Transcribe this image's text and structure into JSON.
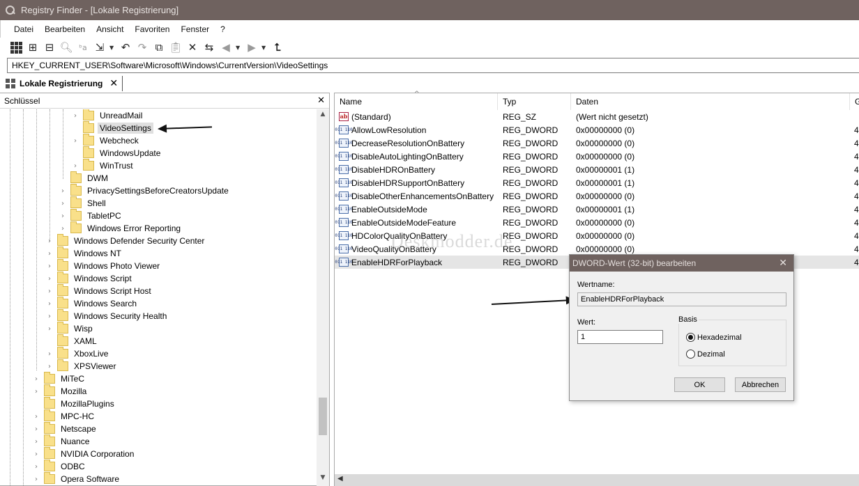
{
  "window": {
    "title": "Registry Finder - [Lokale Registrierung]",
    "accent_color": "#6f625f"
  },
  "menu": {
    "items": [
      "Datei",
      "Bearbeiten",
      "Ansicht",
      "Favoriten",
      "Fenster",
      "?"
    ]
  },
  "toolbar": {
    "icons": [
      "grid-icon",
      "registry-icon",
      "save-icon",
      "search-icon",
      "replace-icon",
      "export-icon",
      "undo-icon",
      "redo-icon",
      "copy-icon",
      "paste-icon",
      "delete-icon",
      "refresh-icon",
      "back-icon",
      "forward-icon",
      "parent-key-icon"
    ]
  },
  "address": {
    "path": "HKEY_CURRENT_USER\\Software\\Microsoft\\Windows\\CurrentVersion\\VideoSettings"
  },
  "tab": {
    "label": "Lokale Registrierung"
  },
  "tree": {
    "header": "Schlüssel",
    "items": [
      {
        "label": "UnreadMail",
        "expandable": true
      },
      {
        "label": "VideoSettings",
        "expandable": false,
        "selected": true
      },
      {
        "label": "Webcheck",
        "expandable": true
      },
      {
        "label": "WindowsUpdate",
        "expandable": false
      },
      {
        "label": "WinTrust",
        "expandable": true
      },
      {
        "label": "DWM",
        "expandable": false
      },
      {
        "label": "PrivacySettingsBeforeCreatorsUpdate",
        "expandable": true
      },
      {
        "label": "Shell",
        "expandable": true
      },
      {
        "label": "TabletPC",
        "expandable": true
      },
      {
        "label": "Windows Error Reporting",
        "expandable": true
      },
      {
        "label": "Windows Defender Security Center",
        "expandable": true
      },
      {
        "label": "Windows NT",
        "expandable": true
      },
      {
        "label": "Windows Photo Viewer",
        "expandable": true
      },
      {
        "label": "Windows Script",
        "expandable": true
      },
      {
        "label": "Windows Script Host",
        "expandable": true
      },
      {
        "label": "Windows Search",
        "expandable": true
      },
      {
        "label": "Windows Security Health",
        "expandable": true
      },
      {
        "label": "Wisp",
        "expandable": true
      },
      {
        "label": "XAML",
        "expandable": false
      },
      {
        "label": "XboxLive",
        "expandable": true
      },
      {
        "label": "XPSViewer",
        "expandable": true
      },
      {
        "label": "MiTeC",
        "expandable": true
      },
      {
        "label": "Mozilla",
        "expandable": true
      },
      {
        "label": "MozillaPlugins",
        "expandable": false
      },
      {
        "label": "MPC-HC",
        "expandable": true
      },
      {
        "label": "Netscape",
        "expandable": true
      },
      {
        "label": "Nuance",
        "expandable": true
      },
      {
        "label": "NVIDIA Corporation",
        "expandable": true
      },
      {
        "label": "ODBC",
        "expandable": true
      },
      {
        "label": "Opera Software",
        "expandable": true
      }
    ]
  },
  "list": {
    "columns": [
      "Name",
      "Typ",
      "Daten",
      "G"
    ],
    "rows": [
      {
        "icon": "string-value-icon",
        "name": "(Standard)",
        "type": "REG_SZ",
        "data": "(Wert nicht gesetzt)",
        "extra": ""
      },
      {
        "icon": "dword-value-icon",
        "name": "AllowLowResolution",
        "type": "REG_DWORD",
        "data": "0x00000000 (0)",
        "extra": "4"
      },
      {
        "icon": "dword-value-icon",
        "name": "DecreaseResolutionOnBattery",
        "type": "REG_DWORD",
        "data": "0x00000000 (0)",
        "extra": "4"
      },
      {
        "icon": "dword-value-icon",
        "name": "DisableAutoLightingOnBattery",
        "type": "REG_DWORD",
        "data": "0x00000000 (0)",
        "extra": "4"
      },
      {
        "icon": "dword-value-icon",
        "name": "DisableHDROnBattery",
        "type": "REG_DWORD",
        "data": "0x00000001 (1)",
        "extra": "4"
      },
      {
        "icon": "dword-value-icon",
        "name": "DisableHDRSupportOnBattery",
        "type": "REG_DWORD",
        "data": "0x00000001 (1)",
        "extra": "4"
      },
      {
        "icon": "dword-value-icon",
        "name": "DisableOtherEnhancementsOnBattery",
        "type": "REG_DWORD",
        "data": "0x00000000 (0)",
        "extra": "4"
      },
      {
        "icon": "dword-value-icon",
        "name": "EnableOutsideMode",
        "type": "REG_DWORD",
        "data": "0x00000001 (1)",
        "extra": "4"
      },
      {
        "icon": "dword-value-icon",
        "name": "EnableOutsideModeFeature",
        "type": "REG_DWORD",
        "data": "0x00000000 (0)",
        "extra": "4"
      },
      {
        "icon": "dword-value-icon",
        "name": "HDColorQualityOnBattery",
        "type": "REG_DWORD",
        "data": "0x00000000 (0)",
        "extra": "4"
      },
      {
        "icon": "dword-value-icon",
        "name": "VideoQualityOnBattery",
        "type": "REG_DWORD",
        "data": "0x00000000 (0)",
        "extra": "4"
      },
      {
        "icon": "dword-value-icon",
        "name": "EnableHDRForPlayback",
        "type": "REG_DWORD",
        "data": "",
        "extra": "4"
      }
    ]
  },
  "watermark": "Deskmodder.de",
  "dialog": {
    "title": "DWORD-Wert (32-bit) bearbeiten",
    "name_label": "Wertname:",
    "name_value": "EnableHDRForPlayback",
    "value_label": "Wert:",
    "value": "1",
    "base_label": "Basis",
    "radio_hex": "Hexadezimal",
    "radio_dec": "Dezimal",
    "selected_base": "Hexadezimal",
    "ok": "OK",
    "cancel": "Abbrechen"
  }
}
